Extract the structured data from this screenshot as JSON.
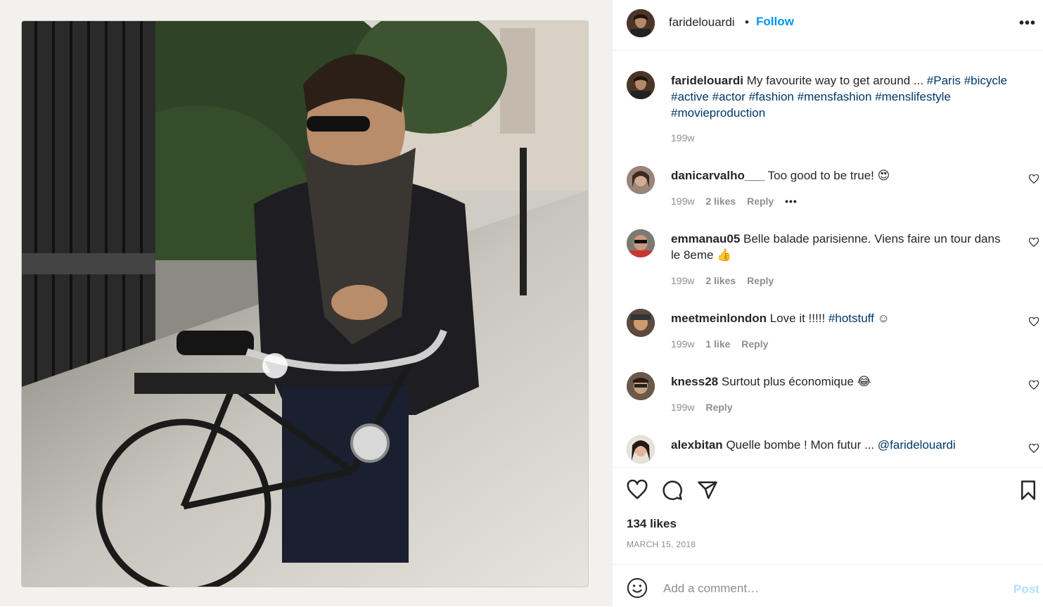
{
  "post": {
    "username": "faridelouardi",
    "follow_label": "Follow",
    "more_label": "•••",
    "header_dot": "•",
    "caption": {
      "username": "faridelouardi",
      "text": "My favourite way to get around ... ",
      "tag1": "#Paris",
      "tag2": "#bicycle",
      "tag3": "#active",
      "tag4": "#actor",
      "tag5": "#fashion",
      "tag6": "#mensfashion",
      "tag7": "#menslifestyle",
      "tag8": "#movieproduction",
      "age": "199w"
    },
    "comments": [
      {
        "username": "danicarvalho___",
        "text": "Too good to be true! 😍",
        "age": "199w",
        "likes": "2 likes",
        "reply": "Reply",
        "more": "•••"
      },
      {
        "username": "emmanau05",
        "text": "Belle balade parisienne. Viens faire un tour dans le 8eme 👍",
        "age": "199w",
        "likes": "2 likes",
        "reply": "Reply"
      },
      {
        "username": "meetmeinlondon",
        "text": "Love it !!!!! ",
        "tag": "#hotstuff",
        "text_end": " ☺",
        "age": "199w",
        "likes": "1 like",
        "reply": "Reply"
      },
      {
        "username": "kness28",
        "text": "Surtout plus économique 😂",
        "age": "199w",
        "reply": "Reply"
      },
      {
        "username": "alexbitan",
        "text": "Quelle bombe ! Mon futur ... ",
        "mention": "@faridelouardi"
      }
    ],
    "likes_count": "134 likes",
    "date": "MARCH 15, 2018",
    "comment_placeholder": "Add a comment…",
    "post_label": "Post"
  },
  "colors": {
    "link": "#00376b",
    "follow": "#0095f6",
    "post_disabled": "#b2dffc",
    "meta": "#8e8e8e"
  }
}
